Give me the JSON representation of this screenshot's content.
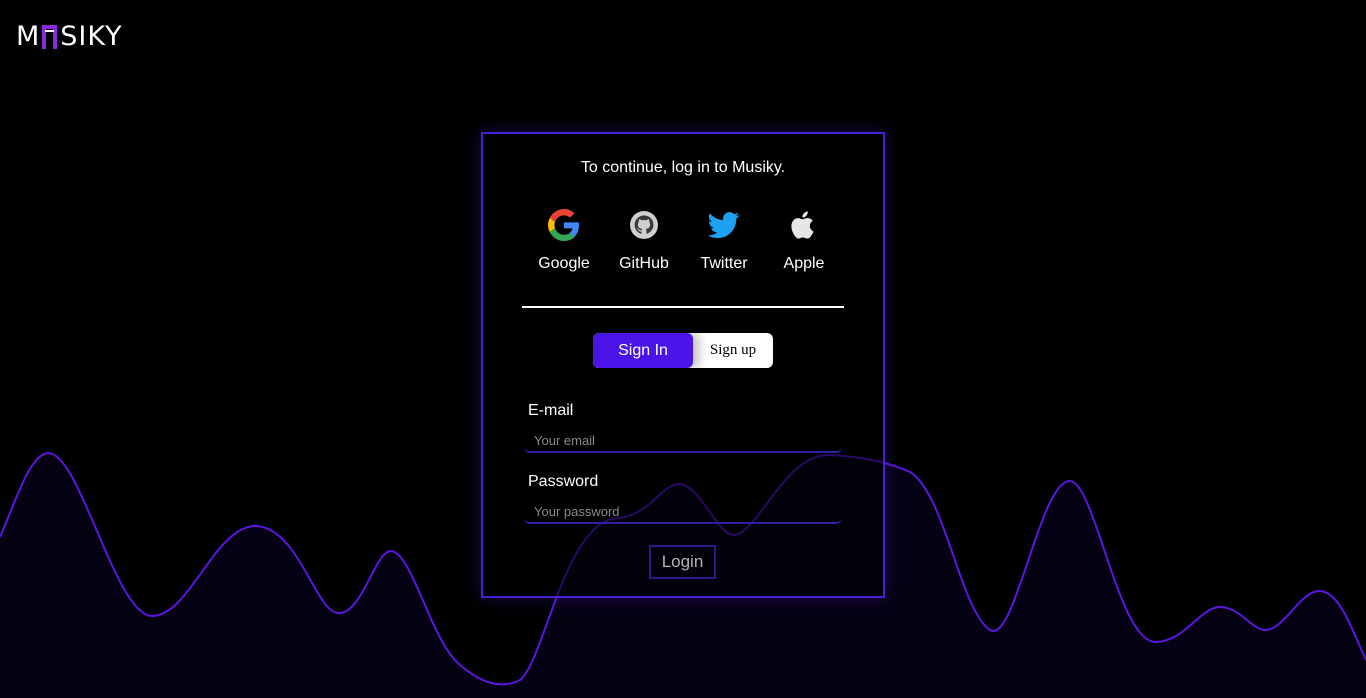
{
  "brand": {
    "name_start": "M",
    "name_end": "SIKY"
  },
  "card": {
    "title": "To continue, log in to Musiky."
  },
  "providers": [
    {
      "label": "Google",
      "icon": "google-icon"
    },
    {
      "label": "GitHub",
      "icon": "github-icon"
    },
    {
      "label": "Twitter",
      "icon": "twitter-icon"
    },
    {
      "label": "Apple",
      "icon": "apple-icon"
    }
  ],
  "auth_toggle": {
    "sign_in": "Sign In",
    "sign_up": "Sign up",
    "active": "sign_in"
  },
  "form": {
    "email_label": "E-mail",
    "email_placeholder": "Your email",
    "email_value": "",
    "password_label": "Password",
    "password_placeholder": "Your password",
    "password_value": "",
    "submit_label": "Login"
  },
  "colors": {
    "accent": "#4a14e6",
    "card_border": "#4a1fd1",
    "wave_stroke": "#5a16dd",
    "logo_u": "#8a2be2",
    "background": "#000000"
  }
}
